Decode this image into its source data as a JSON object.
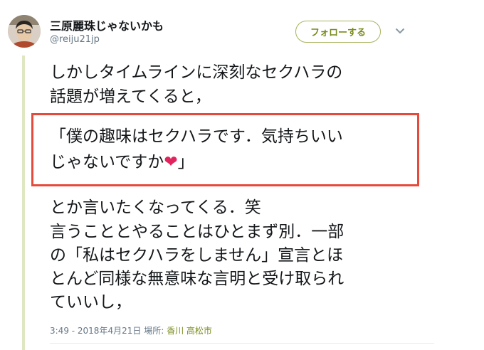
{
  "user": {
    "display_name": "三原麗珠じゃないかも",
    "handle": "@reiju21jp"
  },
  "actions": {
    "follow_label": "フォローする"
  },
  "tweet": {
    "lines_before": [
      "しかしタイムラインに深刻なセクハラの",
      "話題が増えてくると，"
    ],
    "quote_line1": "「僕の趣味はセクハラです．気持ちいい",
    "quote_line2_text": "じゃないですか",
    "quote_heart": "❤",
    "quote_close": "」",
    "lines_after": [
      "とか言いたくなってくる．笑",
      "言うこととやることはひとまず別．一部",
      "の「私はセクハラをしません」宣言とほ",
      "とんど同様な無意味な言明と受け取られ",
      "ていいし，"
    ]
  },
  "meta": {
    "timestamp": "3:49 - 2018年4月21日",
    "location_label": "場所:",
    "location": "香川 高松市"
  },
  "colors": {
    "accent": "#7b8a1d",
    "highlight_border": "#e64a3b",
    "heart": "#e0245e",
    "thread_line": "#dfe6c2"
  }
}
